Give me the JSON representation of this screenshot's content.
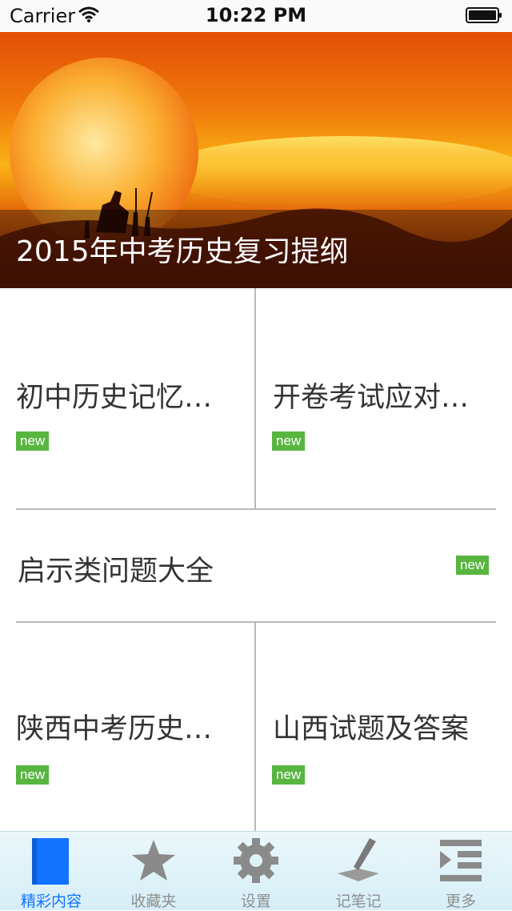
{
  "status_bar": {
    "carrier": "Carrier",
    "time": "10:22 PM"
  },
  "banner": {
    "title": "2015年中考历史复习提纲"
  },
  "grid": {
    "tiles": [
      {
        "title": "初中历史记忆…",
        "badge": "new"
      },
      {
        "title": "开卷考试应对…",
        "badge": "new"
      },
      {
        "title": "启示类问题大全",
        "badge": "new"
      },
      {
        "title": "陕西中考历史…",
        "badge": "new"
      },
      {
        "title": "山西试题及答案",
        "badge": "new"
      }
    ]
  },
  "tab_bar": {
    "accent": "#1173ff",
    "items": [
      {
        "label": "精彩内容",
        "icon": "book-icon",
        "active": true
      },
      {
        "label": "收藏夹",
        "icon": "star-icon",
        "active": false
      },
      {
        "label": "设置",
        "icon": "gear-icon",
        "active": false
      },
      {
        "label": "记笔记",
        "icon": "pen-icon",
        "active": false
      },
      {
        "label": "更多",
        "icon": "more-list-icon",
        "active": false
      }
    ]
  }
}
